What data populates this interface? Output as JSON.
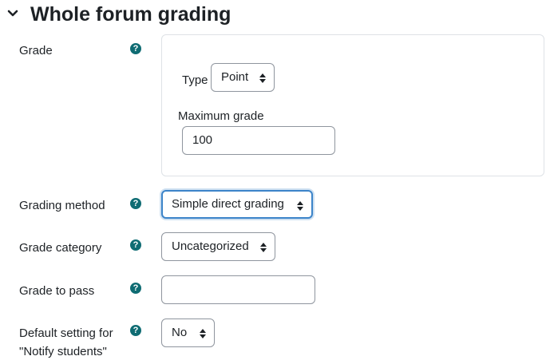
{
  "section": {
    "title": "Whole forum grading",
    "collapse_icon": "chevron-down-icon"
  },
  "help_icon_glyph": "?",
  "grade": {
    "label": "Grade",
    "type_label": "Type",
    "type_value": "Point",
    "max_grade_label": "Maximum grade",
    "max_grade_value": "100"
  },
  "grading_method": {
    "label": "Grading method",
    "value": "Simple direct grading"
  },
  "grade_category": {
    "label": "Grade category",
    "value": "Uncategorized"
  },
  "grade_to_pass": {
    "label": "Grade to pass",
    "value": ""
  },
  "notify_students": {
    "label_line1": "Default setting for",
    "label_line2": "\"Notify students\"",
    "value": "No"
  },
  "colors": {
    "help_icon": "#0f6c73",
    "focus_border": "#3c84c9",
    "text": "#1d2125"
  }
}
